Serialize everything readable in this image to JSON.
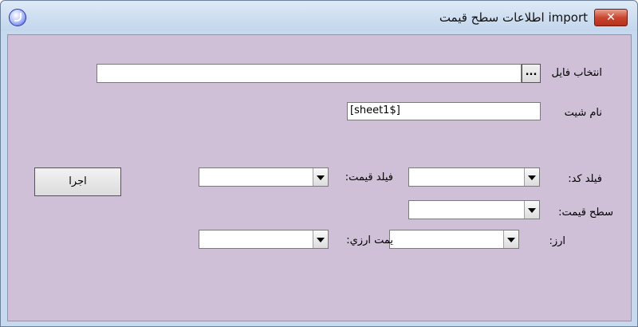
{
  "window": {
    "title": "import اطلاعات سطح قيمت",
    "close_label": "✕"
  },
  "form": {
    "select_file_label": "انتخاب فايل",
    "browse_button_label": "...",
    "file_path_value": "",
    "sheet_name_label": "نام شيت",
    "sheet_name_value": "[sheet1$]",
    "code_field_label": "فيلد كد:",
    "price_field_label": "فيلد قيمت:",
    "price_level_label": "سطح قيمت:",
    "currency_label": "ارز:",
    "currency_price_label": "يمت ارزي:",
    "run_button_label": "اجرا"
  },
  "colors": {
    "client_bg": "#cfc0d8",
    "close_red": "#c94630"
  }
}
